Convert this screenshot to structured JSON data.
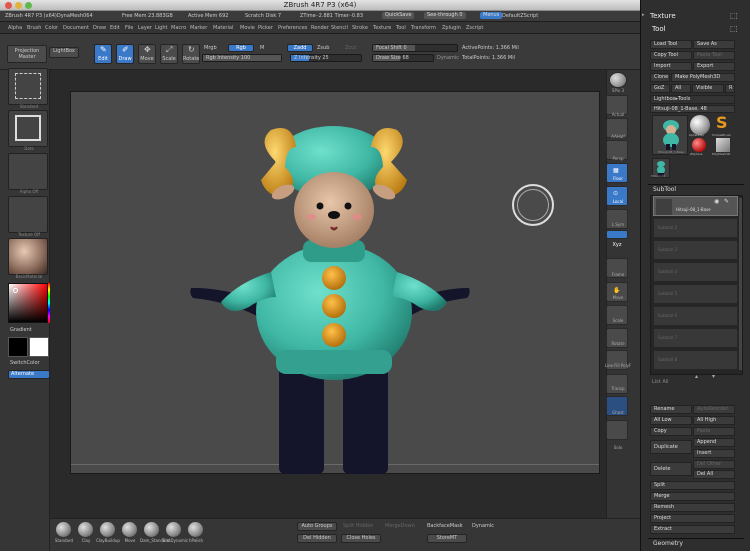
{
  "window": {
    "title": "ZBrush 4R7 P3 (x64)"
  },
  "status": {
    "app": "ZBrush 4R7 P3 (x64)DynaMesh064",
    "free_mem": "Free Mem 23.883GB",
    "active_mem": "Active Mem 692",
    "scratch": "Scratch Disk 7",
    "ztime": "ZTime┈2.881 Timer┈0.83",
    "quicksave": "QuickSave",
    "seethrough": "See-through  0",
    "menus": "Menus",
    "defaultscript": "DefaultZScript"
  },
  "menu": [
    "Alpha",
    "Brush",
    "Color",
    "Document",
    "Draw",
    "Edit",
    "File",
    "Layer",
    "Light",
    "Macro",
    "Marker",
    "Material",
    "Movie",
    "Picker",
    "Preferences",
    "Render",
    "Stencil",
    "Stroke",
    "Texture",
    "Tool",
    "Transform",
    "Zplugin",
    "Zscript"
  ],
  "shelf": {
    "projection_master": "Projection Master",
    "lightbox": "LightBox",
    "edit": "Edit",
    "draw": "Draw",
    "move": "Move",
    "scale": "Scale",
    "rotate": "Rotate",
    "mrgb": "Mrgb",
    "rgb": "Rgb",
    "m": "M",
    "zadd": "Zadd",
    "zsub": "Zsub",
    "zcut": "Zcut",
    "rgb_intensity": "Rgb Intensity 100",
    "z_intensity": "Z Intensity 25",
    "focal_shift": "Focal Shift 0",
    "draw_size": "Draw Size 68",
    "dynamic": "Dynamic",
    "active_points": "ActivePoints: 1.366 Mil",
    "total_points": "TotalPoints: 1.366 Mil"
  },
  "lefttray": {
    "brush_cap": "Standard",
    "stroke_cap": "Dots",
    "alpha_cap": "Alpha Off",
    "texture_cap": "Texture Off",
    "material_cap": "BasicMaterial",
    "gradient": "Gradient",
    "switchcolor": "SwitchColor",
    "alternate": "Alternate"
  },
  "righttray": {
    "spix": "SPix 3",
    "actual": "Actual",
    "aahalf": "AAHalf",
    "persp": "Persp",
    "floor": "Floor",
    "local": "Local",
    "lsym": "L.Sym",
    "xyz": "Xyz",
    "frame": "Frame",
    "move": "Move",
    "scale": "Scale",
    "rotate": "Rotate",
    "linefill": "Line Fill PolyF",
    "transp": "Transp",
    "ghost": "Ghost",
    "solo": "Solo"
  },
  "bottom": {
    "brushes": [
      "Standard",
      "Clay",
      "ClayBuildup",
      "Move",
      "Dam_Standard",
      "TrimDynamic",
      "hPolish"
    ],
    "auto_groups": "Auto Groups",
    "split_hidden": "Split Hidden",
    "merge_down": "MergeDown",
    "backface": "BackfaceMask",
    "dynamic": "Dynamic",
    "del_hidden": "Del Hidden",
    "close_holes": "Close Holes",
    "storemt": "StoreMT"
  },
  "panel": {
    "texture": "Texture",
    "tool": "Tool",
    "load_tool": "Load Tool",
    "save_as": "Save As",
    "copy_tool": "Copy Tool",
    "paste_tool": "Paste Tool",
    "import": "Import",
    "export": "Export",
    "clone": "Clone",
    "make_polymesh": "Make PolyMesh3D",
    "goz": "GoZ",
    "all": "All",
    "visible": "Visible",
    "r": "R",
    "lightbox_tools": "Lightbox▸Tools",
    "current_tool": "Hitsuji-08_1-Base. 48",
    "thumbs": [
      "Hitsuji-08_1-Base",
      "Sphere3D",
      "SimpleBrush",
      "ZSphere",
      "PolyMesh3D",
      "Hitsuji-08"
    ],
    "subtool": "SubTool",
    "subtool_active": "Hitsuji-08_1-Base",
    "subtool_slots": [
      "Subtool 2",
      "Subtool 3",
      "Subtool 4",
      "Subtool 5",
      "Subtool 6",
      "Subtool 7",
      "Subtool 8"
    ],
    "list_all": "List All",
    "rename": "Rename",
    "autoreorder": "AutoReorder",
    "all_low": "All Low",
    "all_high": "All High",
    "copy": "Copy",
    "paste": "Paste",
    "duplicate": "Duplicate",
    "append": "Append",
    "insert": "Insert",
    "delete": "Delete",
    "del_other": "Del Other",
    "del_all": "Del All",
    "split": "Split",
    "merge": "Merge",
    "remesh": "Remesh",
    "project": "Project",
    "extract": "Extract",
    "geometry": "Geometry"
  },
  "colors": {
    "accent": "#3a78c8",
    "body_teal": "#3fb7a4",
    "horn": "#e3a52a",
    "legs": "#14142a"
  }
}
